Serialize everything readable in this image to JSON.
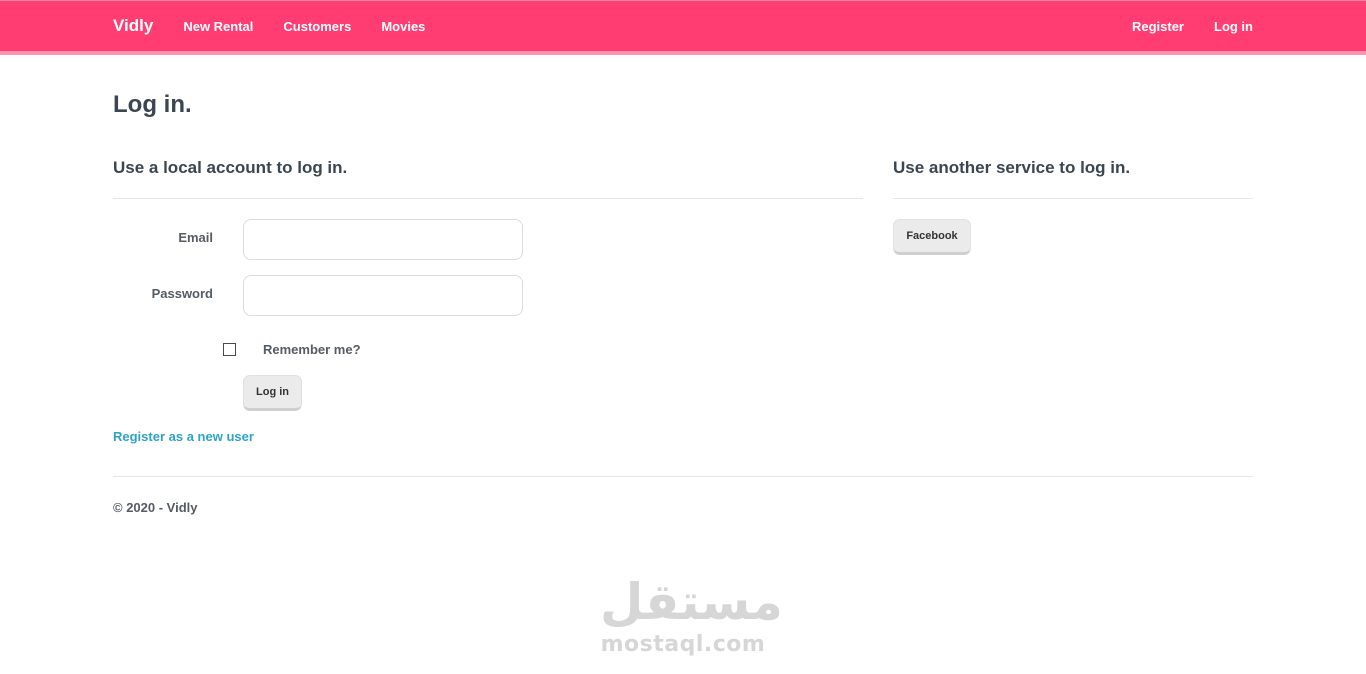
{
  "navbar": {
    "brand": "Vidly",
    "links": [
      "New Rental",
      "Customers",
      "Movies"
    ],
    "right_links": [
      "Register",
      "Log in"
    ],
    "color": "#ff3d72"
  },
  "page": {
    "title": "Log in."
  },
  "local_login": {
    "heading": "Use a local account to log in.",
    "email_label": "Email",
    "email_value": "",
    "password_label": "Password",
    "password_value": "",
    "remember_label": "Remember me?",
    "remember_checked": false,
    "submit_label": "Log in",
    "register_link": "Register as a new user"
  },
  "external_login": {
    "heading": "Use another service to log in.",
    "providers": [
      "Facebook"
    ]
  },
  "footer": {
    "text": "© 2020 - Vidly"
  },
  "watermark": {
    "arabic": "مستقل",
    "latin": "mostaql.com"
  }
}
